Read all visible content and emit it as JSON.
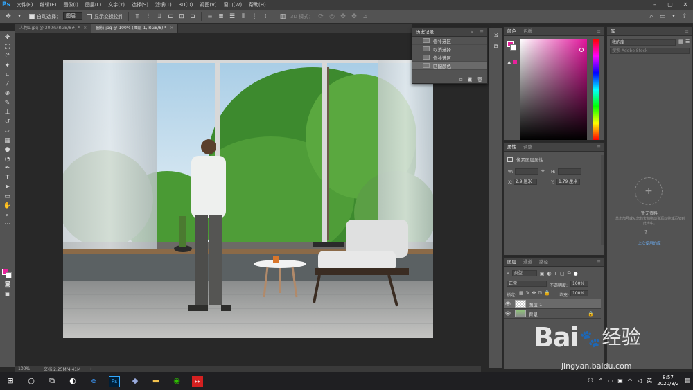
{
  "app": {
    "logo": "Ps"
  },
  "menu": [
    "文件(F)",
    "编辑(E)",
    "图像(I)",
    "图层(L)",
    "文字(Y)",
    "选择(S)",
    "滤镜(T)",
    "3D(D)",
    "视图(V)",
    "窗口(W)",
    "帮助(H)"
  ],
  "options": {
    "auto_select_label": "自动选择：",
    "auto_select_value": "图层",
    "transform_label": "显示变换控件",
    "mode3d_label": "3D 模式："
  },
  "tabs": [
    {
      "label": "人物1.jpg @ 200%(RGB/8#) *",
      "close": "×"
    },
    {
      "label": "窗前.jpg @ 100% (图层 1, RGB/8) *",
      "close": "×"
    }
  ],
  "status": {
    "zoom": "100%",
    "doc": "文档:2.25M/4.41M",
    "arrow": "›"
  },
  "history": {
    "title": "历史记录",
    "items": [
      "修补选区",
      "取消选择",
      "修补选区",
      "匹配颜色"
    ],
    "selected_index": 3
  },
  "color_panel": {
    "tab1": "颜色",
    "tab2": "色板",
    "fg_color": "#e8219b",
    "bg_color": "#ffffff"
  },
  "props_panel": {
    "tab1": "属性",
    "tab2": "调整",
    "heading": "像素图层属性",
    "w_label": "W:",
    "h_label": "H:",
    "x_label": "X:",
    "x_value": "2.9 厘米",
    "y_label": "Y:",
    "y_value": "1.79 厘米"
  },
  "layers_panel": {
    "tabs": [
      "图层",
      "通道",
      "路径"
    ],
    "filter": "类型",
    "blend": "正常",
    "opacity_label": "不透明度:",
    "opacity_value": "100%",
    "lock_label": "锁定:",
    "fill_label": "填充:",
    "fill_value": "100%",
    "layers": [
      {
        "name": "图层 1",
        "selected": true
      },
      {
        "name": "背景",
        "selected": false
      }
    ]
  },
  "library": {
    "title": "库",
    "dropdown": "我的库",
    "search_placeholder": "搜索 Adobe Stock",
    "empty_title": "暂无资料",
    "empty_text": "单击加号或从您的文档拖动资源以将其添加到此库中。",
    "link": "上次使用的库"
  },
  "taskbar": {
    "time": "8:57",
    "date": "2020/3/2"
  },
  "watermark": {
    "brand": "Bai",
    "brand2": "经验",
    "url": "jingyan.baidu.com"
  }
}
